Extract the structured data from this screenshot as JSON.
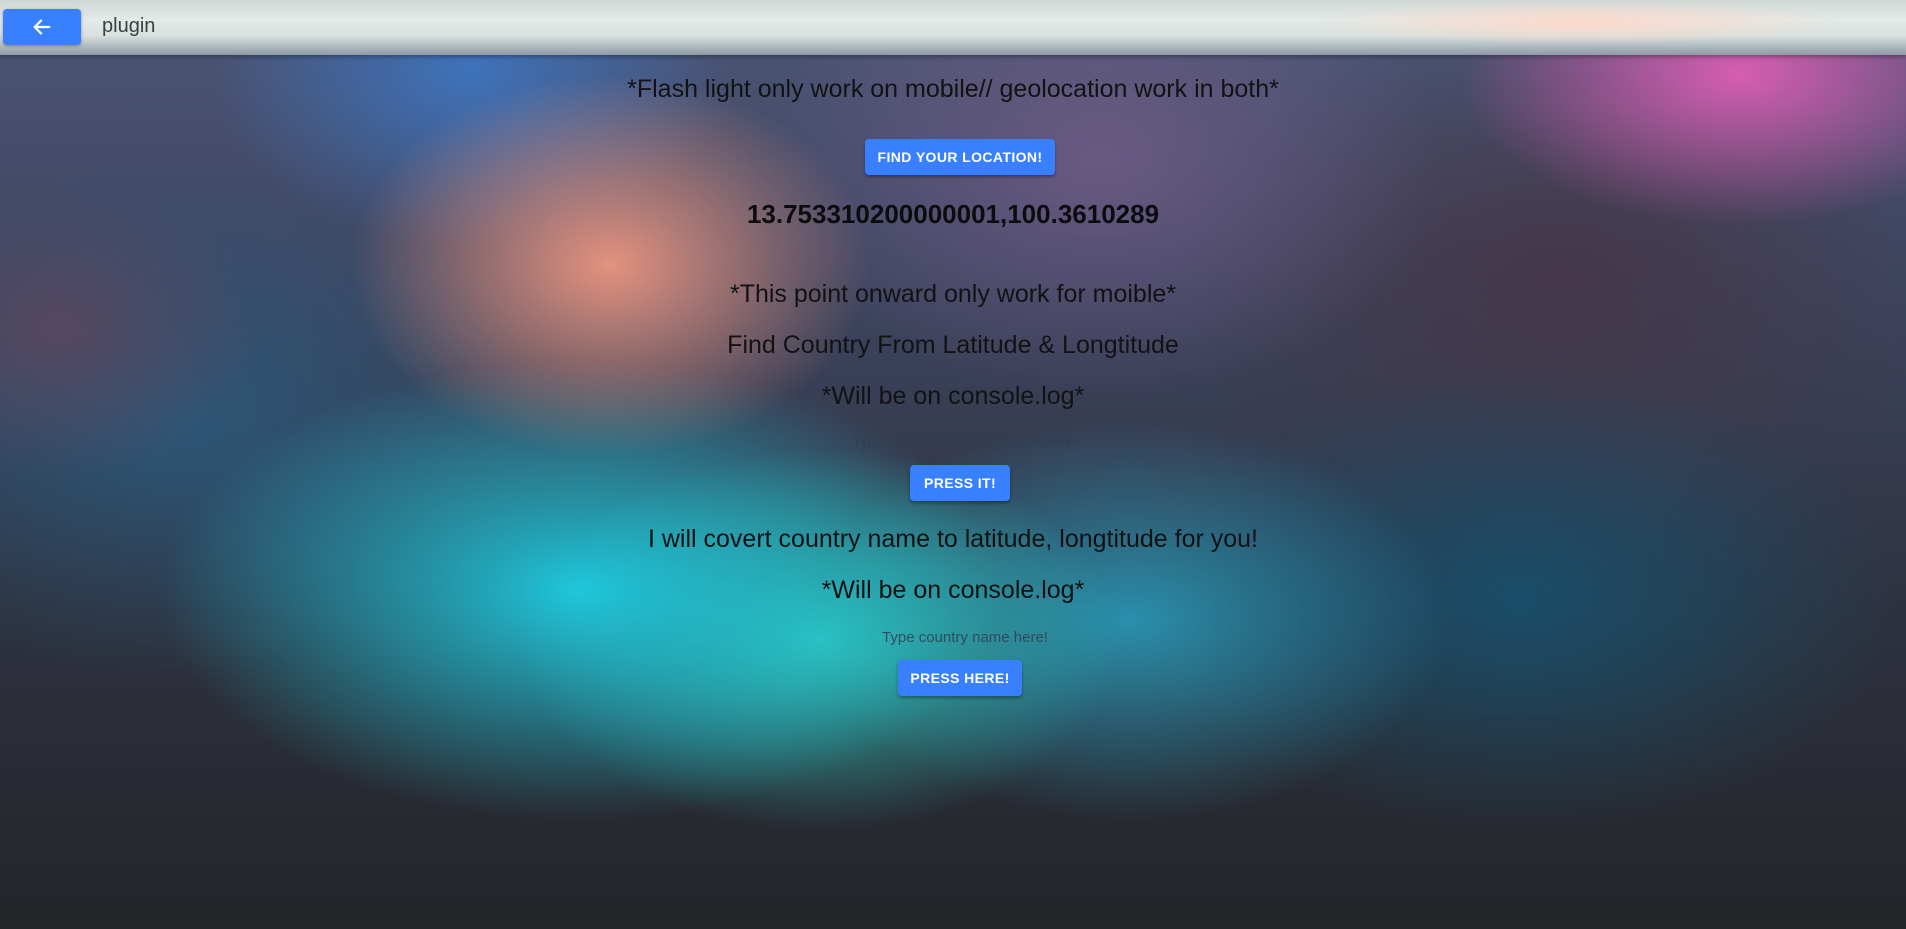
{
  "toolbar": {
    "back_icon": "arrow-left-icon",
    "title": "plugin"
  },
  "main": {
    "flash_note": "*Flash light only work on mobile// geolocation work in both*",
    "find_location_button": "FIND YOUR LOCATION!",
    "coordinates": "13.753310200000001,100.3610289",
    "mobile_note": "*This point onward only work for moible*",
    "reverse_geocode_heading": "Find Country From Latitude & Longtitude",
    "console_note_1": "*Will be on console.log*",
    "latlng_input": {
      "value": "",
      "placeholder": "Type your latitude,longtitude here!"
    },
    "press_it_button": "PRESS IT!",
    "forward_geocode_heading": "I will covert country name to latitude, longtitude for you!",
    "console_note_2": "*Will be on console.log*",
    "country_input": {
      "value": "",
      "placeholder": "Type country name here!"
    },
    "press_here_button": "PRESS HERE!"
  },
  "colors": {
    "primary": "#3880ff",
    "text": "#121214"
  }
}
